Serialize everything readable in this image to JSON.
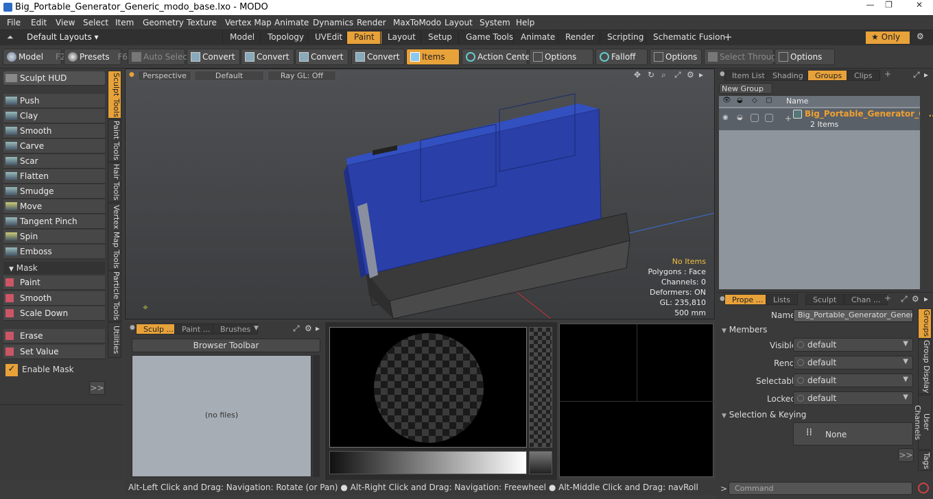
{
  "window": {
    "title": "Big_Portable_Generator_Generic_modo_base.lxo - MODO"
  },
  "menu": [
    "File",
    "Edit",
    "View",
    "Select",
    "Item",
    "Geometry",
    "Texture",
    "Vertex Map",
    "Animate",
    "Dynamics",
    "Render",
    "MaxToModo",
    "Layout",
    "System",
    "Help"
  ],
  "layout_tabs": [
    "Model",
    "Topology",
    "UVEdit",
    "Paint",
    "Layout",
    "Setup",
    "Game Tools",
    "Animate",
    "Render",
    "Scripting",
    "Schematic Fusion"
  ],
  "layout_active": "Paint",
  "default_layouts": "Default Layouts ▾",
  "only_label": "Only",
  "toolbar": {
    "model": "Model",
    "model_key": "F2",
    "presets": "Presets",
    "presets_key": "F6",
    "auto_select": "Auto Select",
    "convert1": "Convert",
    "convert2": "Convert",
    "convert3": "Convert",
    "convert4": "Convert",
    "items": "Items",
    "action_center": "Action Center",
    "options1": "Options",
    "falloff": "Falloff",
    "options2": "Options",
    "select_through": "Select Through",
    "options3": "Options"
  },
  "left": {
    "sculpt_hud": "Sculpt HUD",
    "tools": [
      "Push",
      "Clay",
      "Smooth",
      "Carve",
      "Scar",
      "Flatten",
      "Smudge",
      "Move",
      "Tangent Pinch",
      "Spin",
      "Emboss"
    ],
    "mask_header": "Mask",
    "mask_tools": [
      "Paint",
      "Smooth",
      "Scale Down"
    ],
    "erase": "Erase",
    "set_value": "Set Value",
    "enable_mask": "Enable Mask",
    "more": ">>",
    "vtabs": [
      "Sculpt Tools",
      "Paint Tools",
      "Hair Tools",
      "Vertex Map Tools",
      "Particle Tools",
      "Utilities"
    ]
  },
  "viewport": {
    "perspective": "Perspective",
    "default": "Default",
    "raygl": "Ray GL: Off",
    "info": [
      "No Items",
      "Polygons : Face",
      "Channels: 0",
      "Deformers: ON",
      "GL: 235,810",
      "500 mm"
    ]
  },
  "browser": {
    "tabs": [
      "Sculp ...",
      "Paint ...",
      "Brushes"
    ],
    "toolbar": "Browser Toolbar",
    "empty": "(no files)"
  },
  "groups_panel": {
    "tabs": [
      "Item List",
      "Shading",
      "Groups",
      "Clips"
    ],
    "new_group": "New Group",
    "name_col": "Name",
    "group_name": "Big_Portable_Generator_G...",
    "group_count": "2 Items"
  },
  "props": {
    "tabs": [
      "Prope ...",
      "Lists",
      "Sculpt",
      "Chan ..."
    ],
    "name_label": "Name",
    "name_value": "Big_Portable_Generator_Generic (",
    "members": "Members",
    "rows": [
      [
        "Visible",
        "default"
      ],
      [
        "Render",
        "default"
      ],
      [
        "Selectable",
        "default"
      ],
      [
        "Locked",
        "default"
      ]
    ],
    "sel_keying": "Selection & Keying",
    "none": "None",
    "more": ">>",
    "vtabs": [
      "Groups",
      "Group Display",
      "User Channels",
      "Tags"
    ]
  },
  "status": {
    "hint": "Alt-Left Click and Drag: Navigation: Rotate (or Pan) ● Alt-Right Click and Drag: Navigation: Freewheel ● Alt-Middle Click and Drag: navRoll",
    "command_placeholder": "Command"
  },
  "colors": {
    "accent": "#e8a23a",
    "generator_body": "#2a3fa8"
  }
}
